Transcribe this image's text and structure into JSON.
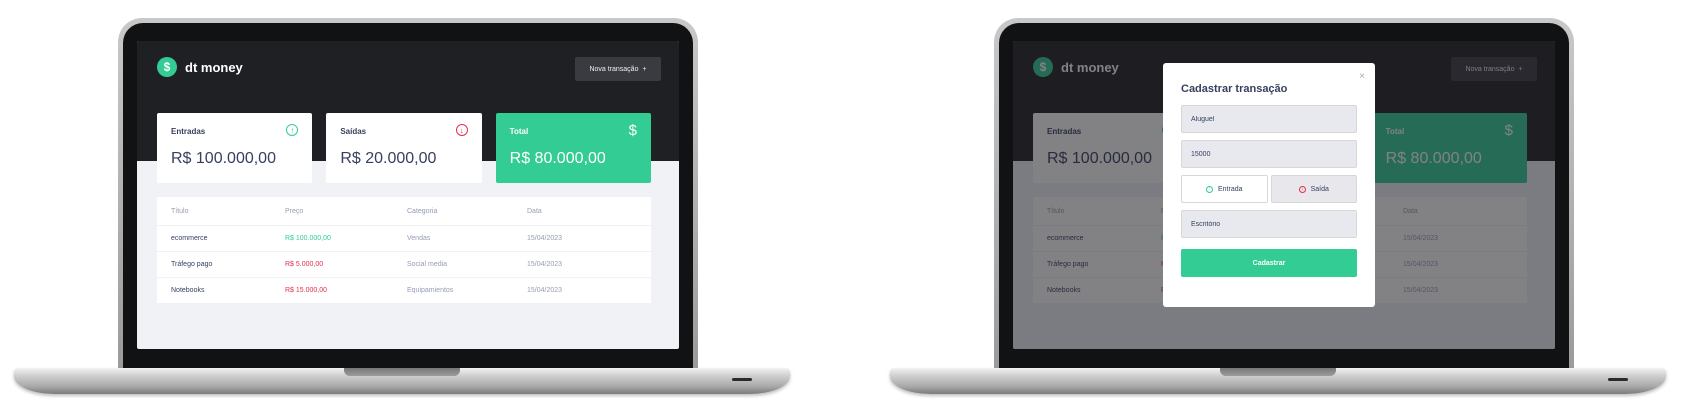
{
  "app": {
    "brand_name": "dt money",
    "new_transaction_label": "Nova transação",
    "summary": {
      "income": {
        "label": "Entradas",
        "value": "R$ 100.000,00"
      },
      "outcome": {
        "label": "Saídas",
        "value": "R$ 20.000,00"
      },
      "total": {
        "label": "Total",
        "value": "R$ 80.000,00"
      }
    },
    "table": {
      "headers": [
        "Título",
        "Preço",
        "Categoria",
        "Data"
      ],
      "rows": [
        {
          "title": "ecommerce",
          "price": "R$ 100.000,00",
          "category": "Vendas",
          "date": "15/04/2023",
          "type": "deposit"
        },
        {
          "title": "Tráfego pago",
          "price": "R$ 5.000,00",
          "category": "Social media",
          "date": "15/04/2023",
          "type": "withdraw"
        },
        {
          "title": "Notebooks",
          "price": "R$ 15.000,00",
          "category": "Equipamientos",
          "date": "15/04/2023",
          "type": "withdraw"
        }
      ]
    }
  },
  "modal": {
    "title": "Cadastrar transação",
    "close_glyph": "×",
    "title_value": "Aluguel",
    "amount_value": "15000",
    "income_label": "Entrada",
    "outcome_label": "Saída",
    "category_value": "Escritório",
    "submit_label": "Cadastrar"
  },
  "icons": {
    "logo": "dollar-sign-icon",
    "income": "arrow-up-circle-icon",
    "outcome": "arrow-down-circle-icon",
    "total": "dollar-icon",
    "add": "plus-icon"
  },
  "colors": {
    "header_bg": "#1f2024",
    "page_bg": "#f0f2f5",
    "accent_green": "#33cc95",
    "accent_red": "#e52e4d",
    "text_title": "#363f5f",
    "text_body": "#969cb3"
  }
}
